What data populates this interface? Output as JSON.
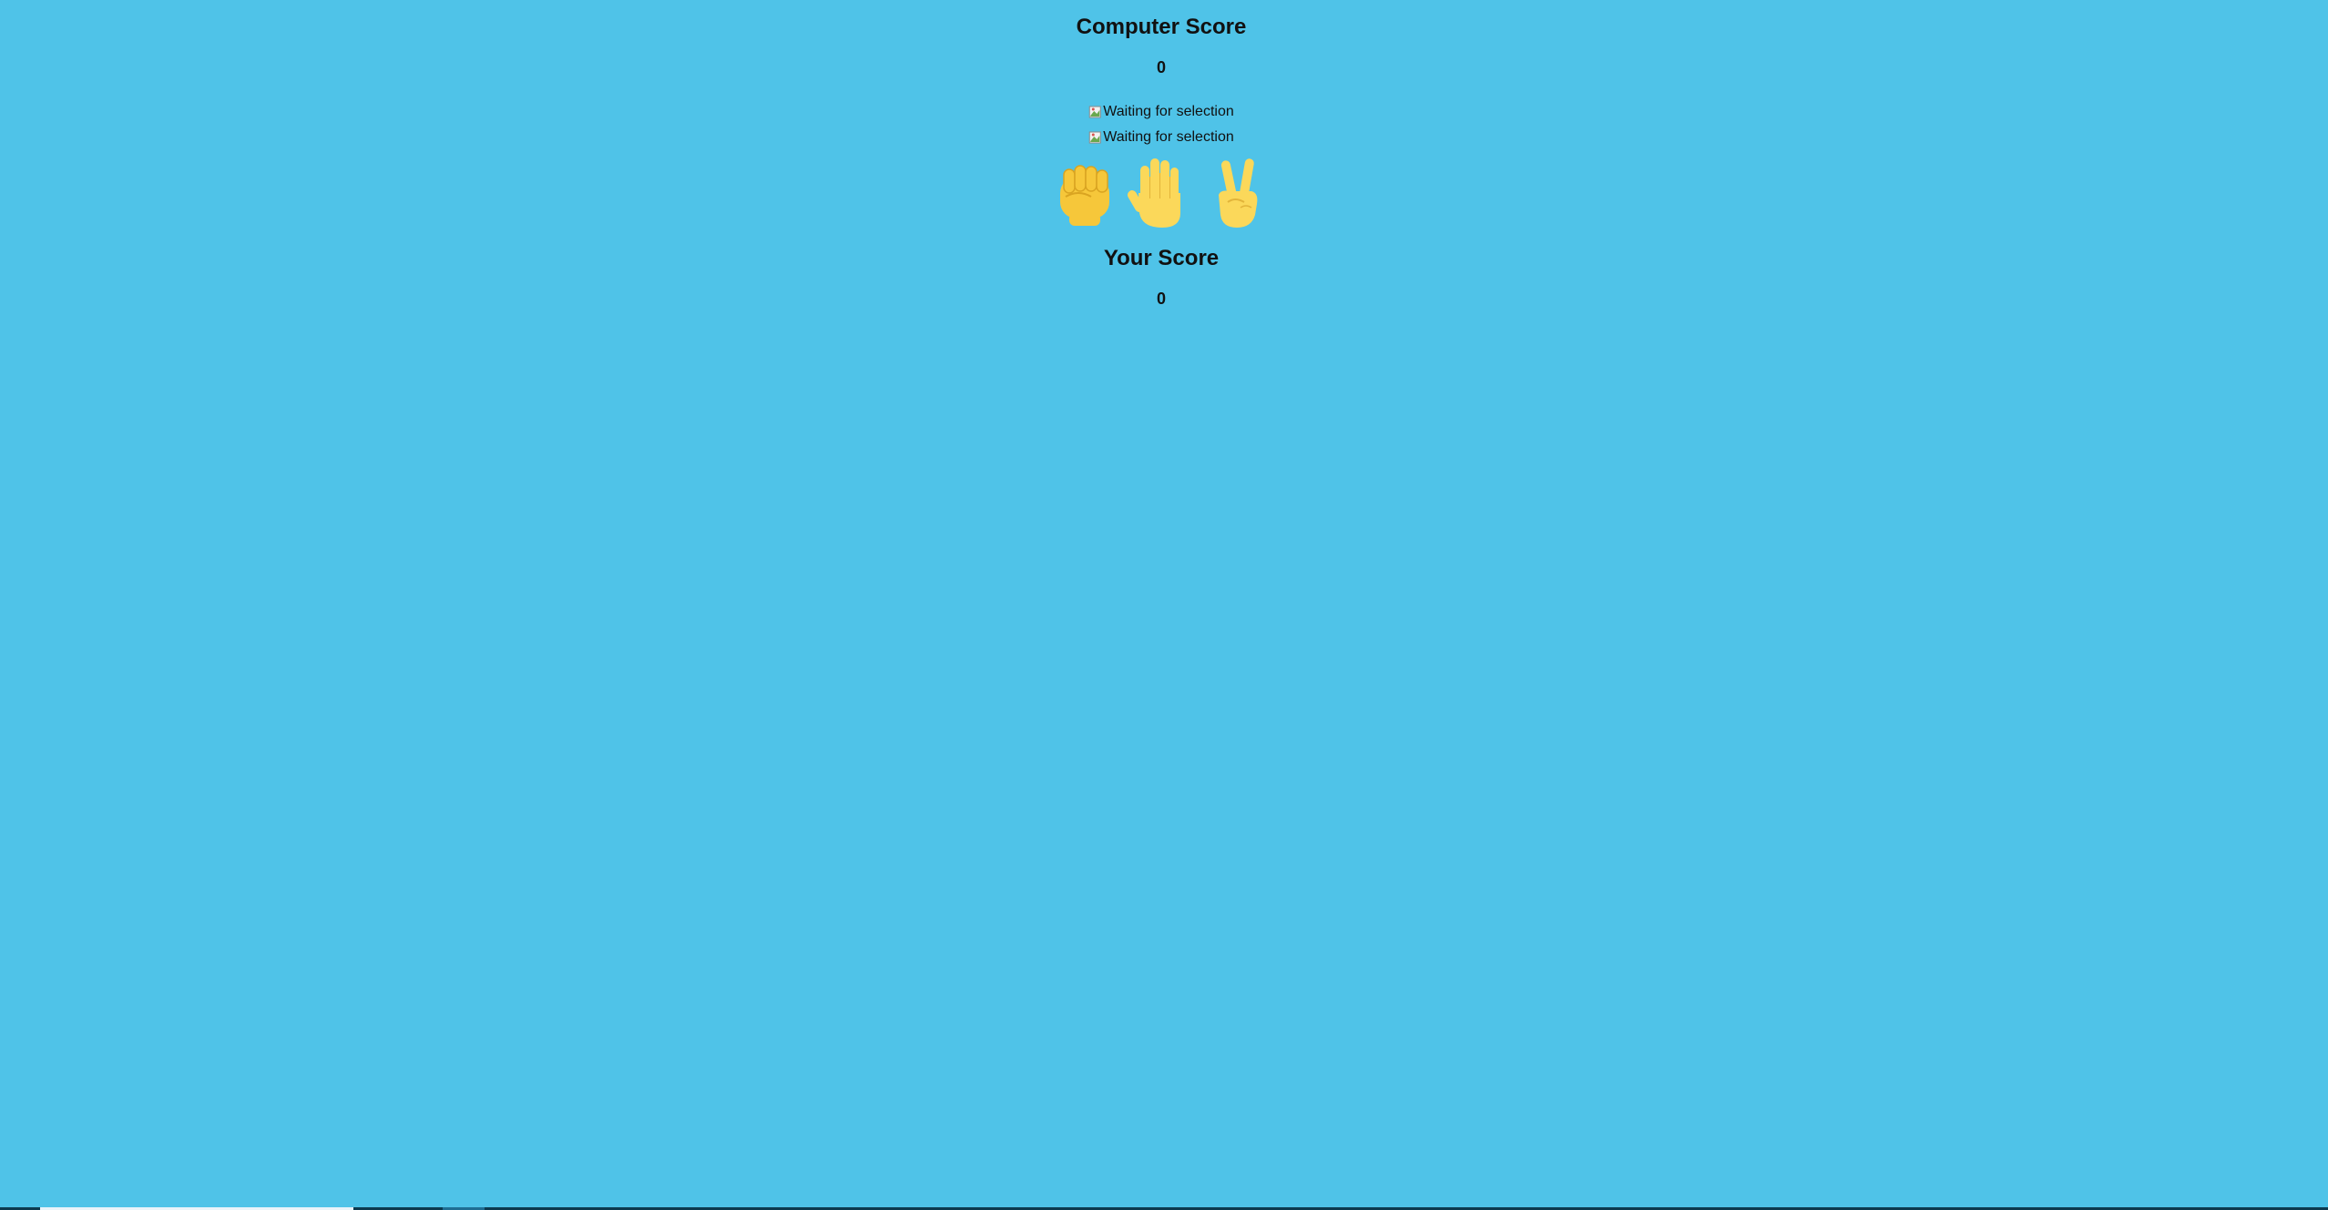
{
  "computer": {
    "heading": "Computer Score",
    "score": "0"
  },
  "selections": {
    "computer_alt": "Waiting for selection",
    "player_alt": "Waiting for selection"
  },
  "choices": [
    {
      "name": "rock",
      "icon": "raised-fist-icon"
    },
    {
      "name": "paper",
      "icon": "raised-hand-icon"
    },
    {
      "name": "scissors",
      "icon": "victory-hand-icon"
    }
  ],
  "player": {
    "heading": "Your Score",
    "score": "0"
  },
  "colors": {
    "background": "#4fc3e8",
    "hand": "#f6c73a"
  }
}
